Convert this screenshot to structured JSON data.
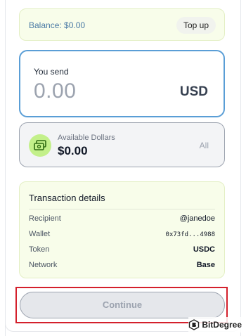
{
  "balance": {
    "text": "Balance: $0.00",
    "topup_label": "Top up"
  },
  "send": {
    "label": "You send",
    "amount": "0.00",
    "currency": "USD"
  },
  "available": {
    "icon": "money-icon",
    "label": "Available Dollars",
    "amount": "$0.00",
    "all_label": "All"
  },
  "details": {
    "title": "Transaction details",
    "rows": [
      {
        "label": "Recipient",
        "value": "@janedoe"
      },
      {
        "label": "Wallet",
        "value": "0x73fd...4988"
      },
      {
        "label": "Token",
        "value": "USDC"
      },
      {
        "label": "Network",
        "value": "Base"
      }
    ]
  },
  "continue_label": "Continue",
  "watermark": "BitDegree",
  "colors": {
    "accent_border": "#5a9ed6",
    "card_bg": "#f8fdea",
    "icon_bg": "#c3f08a",
    "highlight": "#d4202c"
  }
}
